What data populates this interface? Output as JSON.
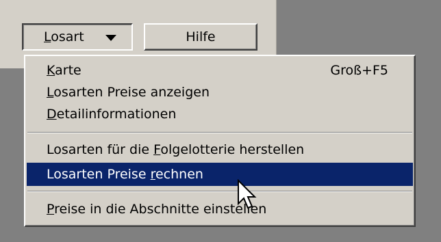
{
  "toolbar": {
    "losart_button": {
      "prefix": "",
      "accel": "L",
      "rest": "osart"
    },
    "hilfe_button": "Hilfe"
  },
  "menu": {
    "items": [
      {
        "prefix": "",
        "accel": "K",
        "rest": "arte",
        "shortcut": "Groß+F5"
      },
      {
        "prefix": "",
        "accel": "L",
        "rest": "osarten Preise anzeigen",
        "shortcut": ""
      },
      {
        "prefix": "",
        "accel": "D",
        "rest": "etailinformationen",
        "shortcut": ""
      },
      {
        "prefix": "Losarten  für die ",
        "accel": "F",
        "rest": "olgelotterie herstellen",
        "shortcut": ""
      },
      {
        "prefix": "Losarten Preise ",
        "accel": "r",
        "rest": "echnen",
        "shortcut": ""
      },
      {
        "prefix": "",
        "accel": "P",
        "rest": "reise in die Abschnitte einstellen",
        "shortcut": ""
      }
    ],
    "highlight_color": "#0a246a"
  },
  "icons": {
    "dropdown": "triangle-down-icon",
    "cursor": "arrow-cursor-icon"
  }
}
